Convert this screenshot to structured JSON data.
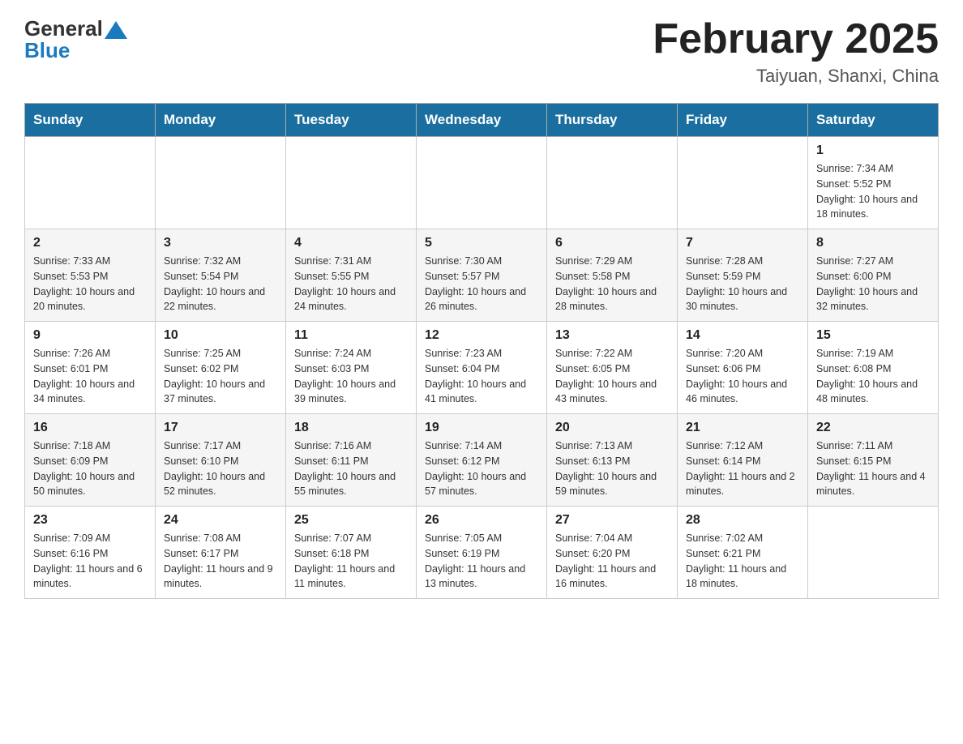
{
  "header": {
    "logo_general": "General",
    "logo_blue": "Blue",
    "month_title": "February 2025",
    "location": "Taiyuan, Shanxi, China"
  },
  "days_of_week": [
    "Sunday",
    "Monday",
    "Tuesday",
    "Wednesday",
    "Thursday",
    "Friday",
    "Saturday"
  ],
  "weeks": [
    [
      {
        "day": "",
        "info": ""
      },
      {
        "day": "",
        "info": ""
      },
      {
        "day": "",
        "info": ""
      },
      {
        "day": "",
        "info": ""
      },
      {
        "day": "",
        "info": ""
      },
      {
        "day": "",
        "info": ""
      },
      {
        "day": "1",
        "info": "Sunrise: 7:34 AM\nSunset: 5:52 PM\nDaylight: 10 hours and 18 minutes."
      }
    ],
    [
      {
        "day": "2",
        "info": "Sunrise: 7:33 AM\nSunset: 5:53 PM\nDaylight: 10 hours and 20 minutes."
      },
      {
        "day": "3",
        "info": "Sunrise: 7:32 AM\nSunset: 5:54 PM\nDaylight: 10 hours and 22 minutes."
      },
      {
        "day": "4",
        "info": "Sunrise: 7:31 AM\nSunset: 5:55 PM\nDaylight: 10 hours and 24 minutes."
      },
      {
        "day": "5",
        "info": "Sunrise: 7:30 AM\nSunset: 5:57 PM\nDaylight: 10 hours and 26 minutes."
      },
      {
        "day": "6",
        "info": "Sunrise: 7:29 AM\nSunset: 5:58 PM\nDaylight: 10 hours and 28 minutes."
      },
      {
        "day": "7",
        "info": "Sunrise: 7:28 AM\nSunset: 5:59 PM\nDaylight: 10 hours and 30 minutes."
      },
      {
        "day": "8",
        "info": "Sunrise: 7:27 AM\nSunset: 6:00 PM\nDaylight: 10 hours and 32 minutes."
      }
    ],
    [
      {
        "day": "9",
        "info": "Sunrise: 7:26 AM\nSunset: 6:01 PM\nDaylight: 10 hours and 34 minutes."
      },
      {
        "day": "10",
        "info": "Sunrise: 7:25 AM\nSunset: 6:02 PM\nDaylight: 10 hours and 37 minutes."
      },
      {
        "day": "11",
        "info": "Sunrise: 7:24 AM\nSunset: 6:03 PM\nDaylight: 10 hours and 39 minutes."
      },
      {
        "day": "12",
        "info": "Sunrise: 7:23 AM\nSunset: 6:04 PM\nDaylight: 10 hours and 41 minutes."
      },
      {
        "day": "13",
        "info": "Sunrise: 7:22 AM\nSunset: 6:05 PM\nDaylight: 10 hours and 43 minutes."
      },
      {
        "day": "14",
        "info": "Sunrise: 7:20 AM\nSunset: 6:06 PM\nDaylight: 10 hours and 46 minutes."
      },
      {
        "day": "15",
        "info": "Sunrise: 7:19 AM\nSunset: 6:08 PM\nDaylight: 10 hours and 48 minutes."
      }
    ],
    [
      {
        "day": "16",
        "info": "Sunrise: 7:18 AM\nSunset: 6:09 PM\nDaylight: 10 hours and 50 minutes."
      },
      {
        "day": "17",
        "info": "Sunrise: 7:17 AM\nSunset: 6:10 PM\nDaylight: 10 hours and 52 minutes."
      },
      {
        "day": "18",
        "info": "Sunrise: 7:16 AM\nSunset: 6:11 PM\nDaylight: 10 hours and 55 minutes."
      },
      {
        "day": "19",
        "info": "Sunrise: 7:14 AM\nSunset: 6:12 PM\nDaylight: 10 hours and 57 minutes."
      },
      {
        "day": "20",
        "info": "Sunrise: 7:13 AM\nSunset: 6:13 PM\nDaylight: 10 hours and 59 minutes."
      },
      {
        "day": "21",
        "info": "Sunrise: 7:12 AM\nSunset: 6:14 PM\nDaylight: 11 hours and 2 minutes."
      },
      {
        "day": "22",
        "info": "Sunrise: 7:11 AM\nSunset: 6:15 PM\nDaylight: 11 hours and 4 minutes."
      }
    ],
    [
      {
        "day": "23",
        "info": "Sunrise: 7:09 AM\nSunset: 6:16 PM\nDaylight: 11 hours and 6 minutes."
      },
      {
        "day": "24",
        "info": "Sunrise: 7:08 AM\nSunset: 6:17 PM\nDaylight: 11 hours and 9 minutes."
      },
      {
        "day": "25",
        "info": "Sunrise: 7:07 AM\nSunset: 6:18 PM\nDaylight: 11 hours and 11 minutes."
      },
      {
        "day": "26",
        "info": "Sunrise: 7:05 AM\nSunset: 6:19 PM\nDaylight: 11 hours and 13 minutes."
      },
      {
        "day": "27",
        "info": "Sunrise: 7:04 AM\nSunset: 6:20 PM\nDaylight: 11 hours and 16 minutes."
      },
      {
        "day": "28",
        "info": "Sunrise: 7:02 AM\nSunset: 6:21 PM\nDaylight: 11 hours and 18 minutes."
      },
      {
        "day": "",
        "info": ""
      }
    ]
  ]
}
